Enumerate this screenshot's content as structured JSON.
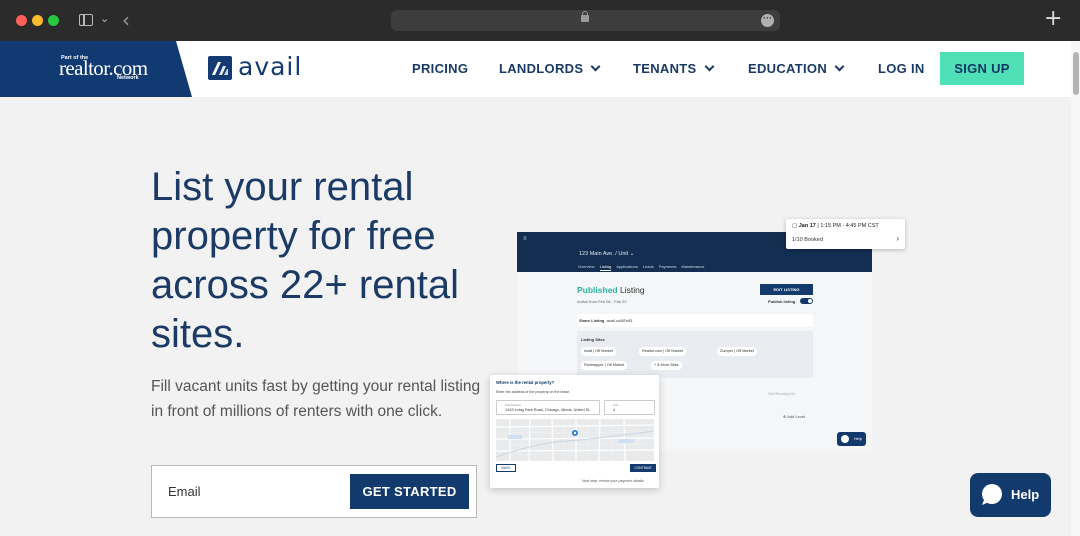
{
  "browser": {
    "icons": [
      "sidebar-icon",
      "chevron-down-icon",
      "back-icon",
      "lock-icon",
      "more-icon",
      "new-tab-icon"
    ]
  },
  "header": {
    "partner_pre": "Part of the",
    "partner_brand": "realtor.com",
    "partner_post": "Network",
    "brand": "avail",
    "nav": {
      "pricing": "PRICING",
      "landlords": "LANDLORDS",
      "tenants": "TENANTS",
      "education": "EDUCATION",
      "login": "LOG IN",
      "signup": "SIGN UP"
    },
    "colors": {
      "navy": "#133a6c",
      "accent": "#4fe0b8",
      "partner_bg": "#123a72"
    }
  },
  "hero": {
    "title": "List your rental property for free across 22+ rental sites.",
    "subtitle": "Fill vacant units fast by getting your rental listing in front of millions of renters with one click.",
    "email_placeholder": "Email",
    "cta": "GET STARTED"
  },
  "mockup": {
    "menu": "≡",
    "address": "123 Main Ave. / Unit ⌄",
    "tabs": [
      "Overview",
      "Listing",
      "Applications",
      "Leads",
      "Payments",
      "Maintenance"
    ],
    "published_word": "Published",
    "listing_word": "Listing",
    "active_from": "Active from Feb 06 - Feb 20",
    "edit_listing": "EDIT LISTING",
    "publish_listing": "Publish listing",
    "share_listing": "Share Listing",
    "share_code": "avail.co/8Fs93",
    "listing_sites": "Listing Sites",
    "sites": [
      "Avail | Off Market",
      "Realtor.com | Off Market",
      "Zumper | Off Market",
      "Padmapper | Off Market",
      "+ 8 More Sites"
    ],
    "map_faint": "Self Showing Info",
    "add_level": "⊕ Add Level",
    "help": "Help",
    "calendar": {
      "date": "Jan 17",
      "time": "| 1:15 PM - 4:45 PM CST",
      "booked": "1/10 Booked"
    },
    "modal": {
      "title": "Where is the rental property?",
      "subtitle": "Enter the address of the property on the lease.",
      "addr_label": "Unit Address",
      "addr_value": "1243 Irving Park Road, Chicago, Illinois, United St...",
      "unit_label": "Unit",
      "unit_value": "4",
      "back": "BACK",
      "continue": "CONTINUE",
      "next_step": "Next step: review your payment details"
    }
  },
  "help_widget": {
    "label": "Help"
  }
}
